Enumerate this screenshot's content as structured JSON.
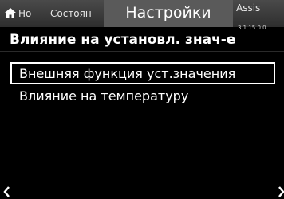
{
  "header": {
    "home_tab_label": "Но",
    "state_tab_label": "Состоян",
    "active_tab_label": "Настройки",
    "assist_tab_label": "Assis",
    "version": "3.1.15.0.0."
  },
  "page": {
    "title": "Влияние на установл. знач-е"
  },
  "menu": {
    "items": [
      {
        "label": "Внешняя функция уст.значения",
        "selected": true
      },
      {
        "label": "Влияние на температуру",
        "selected": false
      }
    ]
  },
  "icons": {
    "home": "home-icon",
    "back": "chevron-left-icon",
    "forward": "chevron-right-icon"
  },
  "colors": {
    "background": "#000000",
    "tab_bar": "#3c3c3c",
    "active_tab": "#5a5a5a",
    "text": "#ffffff",
    "selection_border": "#ffffff"
  }
}
